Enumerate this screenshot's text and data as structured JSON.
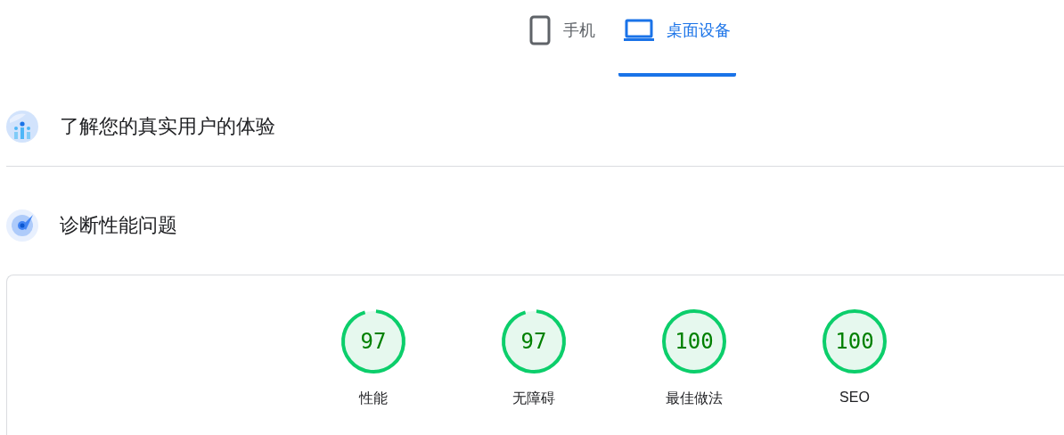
{
  "tabs": [
    {
      "label": "手机",
      "selected": false
    },
    {
      "label": "桌面设备",
      "selected": true
    }
  ],
  "sections": [
    {
      "title": "了解您的真实用户的体验"
    },
    {
      "title": "诊断性能问题"
    }
  ],
  "scores": [
    {
      "value": "97",
      "label": "性能"
    },
    {
      "value": "97",
      "label": "无障碍"
    },
    {
      "value": "100",
      "label": "最佳做法"
    },
    {
      "value": "100",
      "label": "SEO"
    }
  ]
}
